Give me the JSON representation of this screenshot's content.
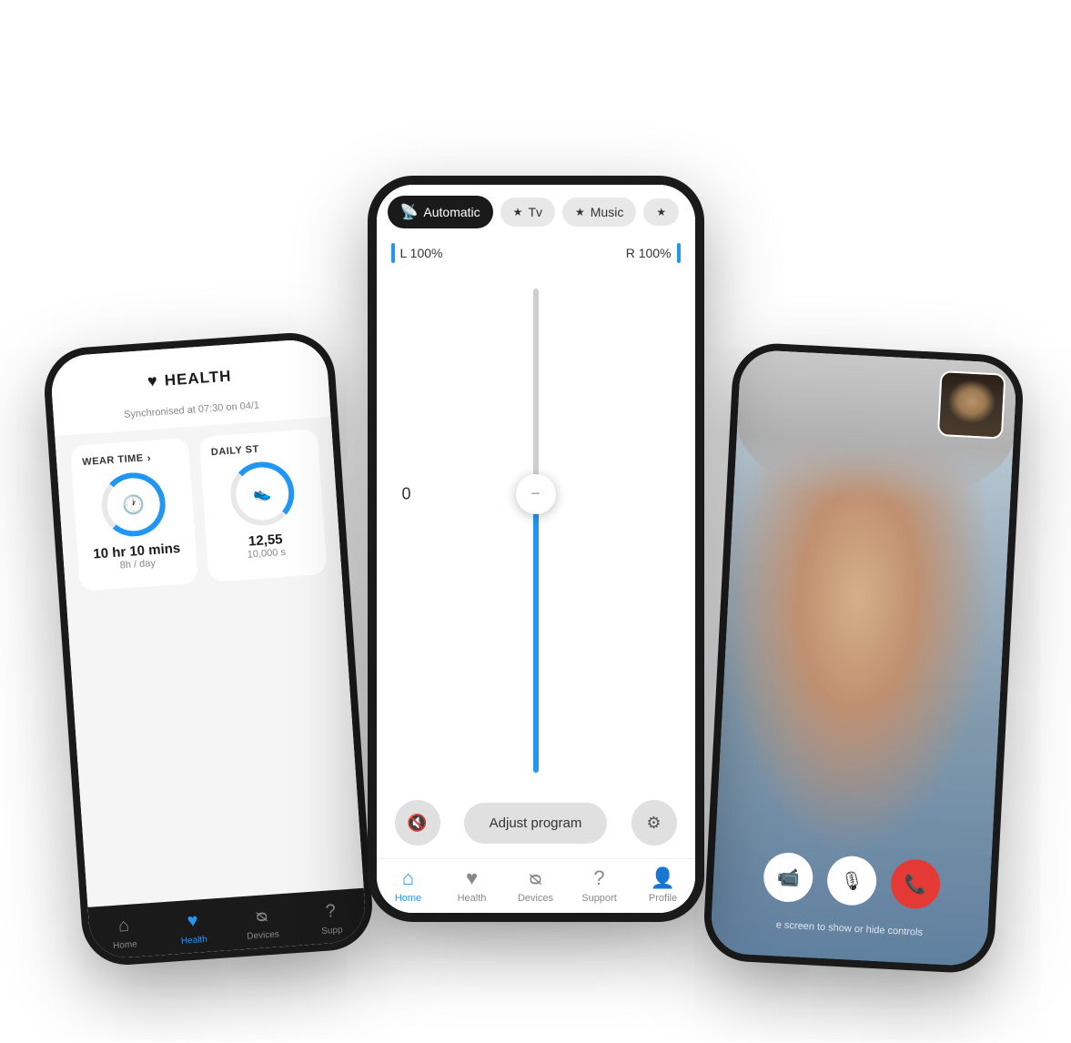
{
  "scene": {
    "phones": {
      "left": {
        "header_title": "HEALTH",
        "sync_text": "Synchronised at 07:30 on 04/1",
        "wear_time_label": "WEAR TIME",
        "daily_steps_label": "DAILY ST",
        "wear_time_value": "10 hr 10 mins",
        "wear_time_sub": "8h / day",
        "daily_steps_value": "12,55",
        "daily_steps_sub": "10,000 s",
        "nav_items": [
          {
            "label": "Home",
            "icon": "🏠",
            "active": false
          },
          {
            "label": "Health",
            "icon": "♥",
            "active": true
          },
          {
            "label": "Devices",
            "icon": "🎧",
            "active": false
          },
          {
            "label": "Supp",
            "icon": "?",
            "active": false
          }
        ]
      },
      "center": {
        "tabs": [
          {
            "label": "Automatic",
            "icon": "📡",
            "active": true
          },
          {
            "label": "Tv",
            "icon": "★",
            "active": false
          },
          {
            "label": "Music",
            "icon": "★",
            "active": false
          },
          {
            "label": "...",
            "icon": "★",
            "active": false
          }
        ],
        "vol_left": "L 100%",
        "vol_right": "R 100%",
        "slider_zero": "0",
        "adjust_program_label": "Adjust program",
        "nav_items": [
          {
            "label": "Home",
            "icon": "🏠",
            "active": true
          },
          {
            "label": "Health",
            "icon": "♥",
            "active": false
          },
          {
            "label": "Devices",
            "icon": "🎧",
            "active": false
          },
          {
            "label": "Support",
            "icon": "?",
            "active": false
          },
          {
            "label": "Profile",
            "icon": "👤",
            "active": false
          }
        ]
      },
      "right": {
        "tap_screen_text": "e screen to show or hide controls",
        "call_controls": [
          {
            "label": "video",
            "type": "video"
          },
          {
            "label": "mic",
            "type": "mic"
          },
          {
            "label": "end",
            "type": "end"
          }
        ]
      }
    }
  }
}
